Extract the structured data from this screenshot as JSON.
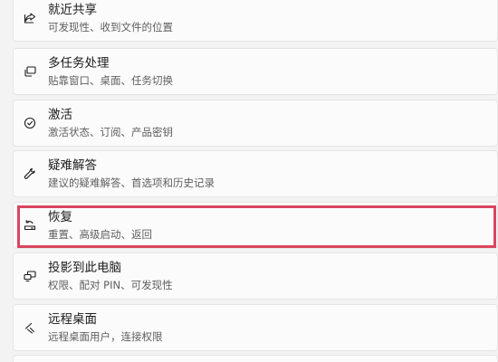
{
  "settings_list": {
    "items": [
      {
        "title": "就近共享",
        "desc": "可发现性、收到文件的位置",
        "icon": "share-icon"
      },
      {
        "title": "多任务处理",
        "desc": "贴靠窗口、桌面、任务切换",
        "icon": "multitask-icon"
      },
      {
        "title": "激活",
        "desc": "激活状态、订阅、产品密钥",
        "icon": "checkmark-circle-icon"
      },
      {
        "title": "疑难解答",
        "desc": "建议的疑难解答、首选项和历史记录",
        "icon": "wrench-icon"
      },
      {
        "title": "恢复",
        "desc": "重置、高级启动、返回",
        "icon": "recovery-icon"
      },
      {
        "title": "投影到此电脑",
        "desc": "权限、配对 PIN、可发现性",
        "icon": "project-icon"
      },
      {
        "title": "远程桌面",
        "desc": "远程桌面用户，连接权限",
        "icon": "remote-desktop-icon"
      }
    ],
    "highlighted_item": "恢复"
  },
  "colors": {
    "highlight_border": "#d9465f",
    "card_background": "#fbfbfb",
    "page_background": "#f3f3f3"
  }
}
